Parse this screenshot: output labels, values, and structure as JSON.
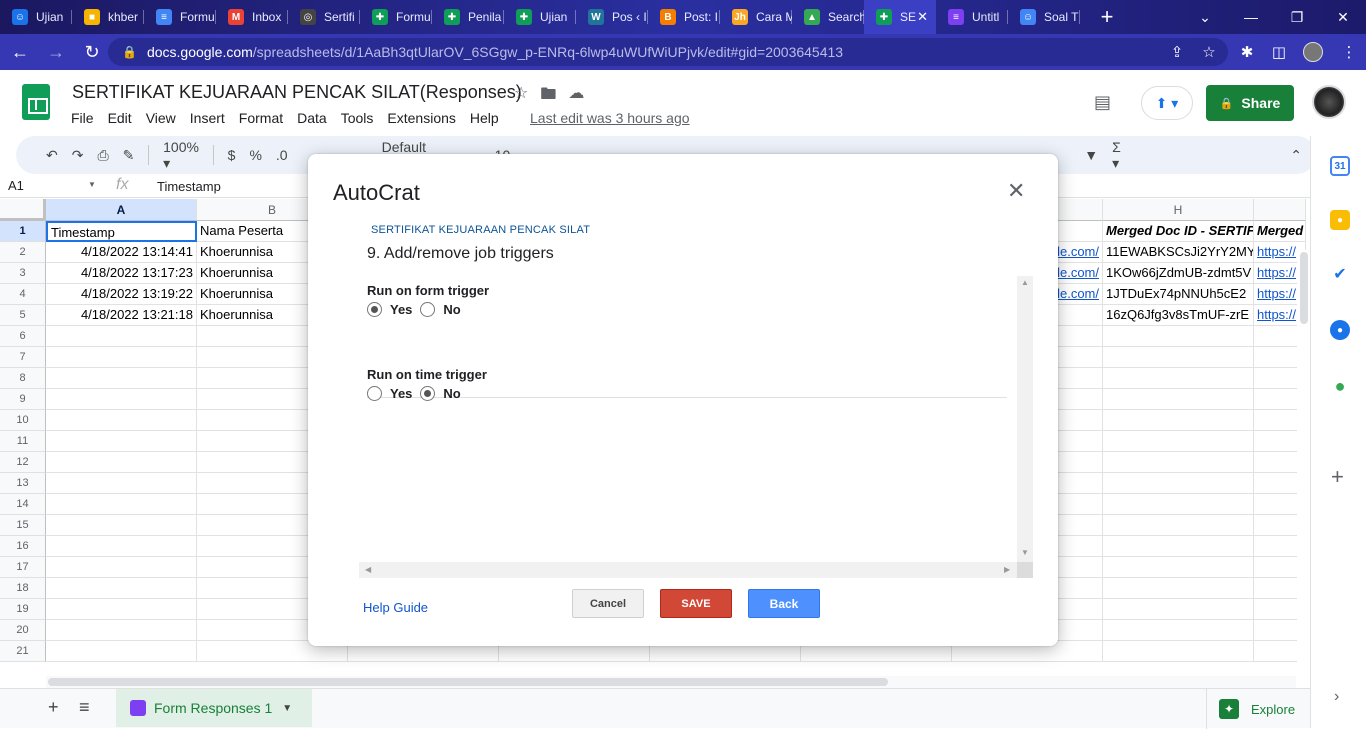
{
  "browser": {
    "tabs": [
      {
        "label": "Ujian",
        "color": "#1a73e8",
        "glyph": "☺"
      },
      {
        "label": "khber",
        "color": "#f4b400",
        "glyph": "■"
      },
      {
        "label": "Formu",
        "color": "#4285f4",
        "glyph": "≡"
      },
      {
        "label": "Inbox",
        "color": "#ea4335",
        "glyph": "M"
      },
      {
        "label": "Sertifi",
        "color": "#444444",
        "glyph": "◎"
      },
      {
        "label": "Formu",
        "color": "#0f9d58",
        "glyph": "✚"
      },
      {
        "label": "Penila",
        "color": "#0f9d58",
        "glyph": "✚"
      },
      {
        "label": "Ujian",
        "color": "#0f9d58",
        "glyph": "✚"
      },
      {
        "label": "Pos ‹ I",
        "color": "#21759b",
        "glyph": "W"
      },
      {
        "label": "Post: I",
        "color": "#f57d00",
        "glyph": "B"
      },
      {
        "label": "Cara M",
        "color": "#f9a825",
        "glyph": "Jh"
      },
      {
        "label": "Search",
        "color": "#34a853",
        "glyph": "▲"
      },
      {
        "label": "SE",
        "color": "#0f9d58",
        "glyph": "✚",
        "active": true
      },
      {
        "label": "Untitl",
        "color": "#7e3ff2",
        "glyph": "≡"
      },
      {
        "label": "Soal T",
        "color": "#4285f4",
        "glyph": "☺"
      }
    ],
    "newtab_glyph": "+",
    "url_host": "docs.google.com",
    "url_path": "/spreadsheets/d/1AaBh3qtUlarOV_6SGgw_p-ENRq-6lwp4uWUfWiUPjvk/edit#gid=2003645413"
  },
  "sheets": {
    "title": "SERTIFIKAT KEJUARAAN PENCAK SILAT(Responses)",
    "menu": [
      "File",
      "Edit",
      "View",
      "Insert",
      "Format",
      "Data",
      "Tools",
      "Extensions",
      "Help"
    ],
    "last_edit": "Last edit was 3 hours ago",
    "share_label": "Share",
    "zoom": "100%",
    "currency": "$",
    "percent": "%",
    "decimal": ".0",
    "font_name": "Default (Ari...",
    "font_size": "10",
    "name_box": "A1",
    "formula_content": "Timestamp",
    "columns": [
      "A",
      "B",
      "H"
    ],
    "row_numbers": [
      "1",
      "2",
      "3",
      "4",
      "5",
      "6",
      "7",
      "8",
      "9",
      "10",
      "11",
      "12",
      "13",
      "14",
      "15",
      "16",
      "17",
      "18",
      "19",
      "20",
      "21"
    ],
    "cells": {
      "a1": "Timestamp",
      "b1": "Nama Peserta",
      "h1": "Merged Doc ID - SERTIFIKAT",
      "i1": "Merged Doc",
      "a": [
        "4/18/2022 13:14:41",
        "4/18/2022 13:17:23",
        "4/18/2022 13:19:22",
        "4/18/2022 13:21:18"
      ],
      "b": [
        "Khoerunnisa",
        "Khoerunnisa",
        "Khoerunnisa",
        "Khoerunnisa"
      ],
      "g": [
        "le.com/",
        "le.com/",
        "le.com/"
      ],
      "h": [
        "11EWABKSCsJi2YrY2MY",
        "1KOw66jZdmUB-zdmt5V",
        "1JTDuEx74pNNUh5cE2",
        "16zQ6Jfg3v8sTmUF-zrE"
      ],
      "i": [
        "https://",
        "https://",
        "https://",
        "https://"
      ]
    },
    "sheet_tab": "Form Responses 1",
    "explore_label": "Explore"
  },
  "dialog": {
    "title": "AutoCrat",
    "project_name": "SERTIFIKAT KEJUARAAN PENCAK SILAT",
    "step_title": "9. Add/remove job triggers",
    "form_trigger_label": "Run on form trigger",
    "time_trigger_label": "Run on time trigger",
    "yes_label": "Yes",
    "no_label": "No",
    "form_trigger_value": "Yes",
    "time_trigger_value": "No",
    "help_label": "Help Guide",
    "cancel_label": "Cancel",
    "save_label": "SAVE",
    "back_label": "Back"
  },
  "colors": {
    "share_green": "#188038",
    "save_red": "#d14836",
    "back_blue": "#4d90fe",
    "link_blue": "#1155cc"
  }
}
